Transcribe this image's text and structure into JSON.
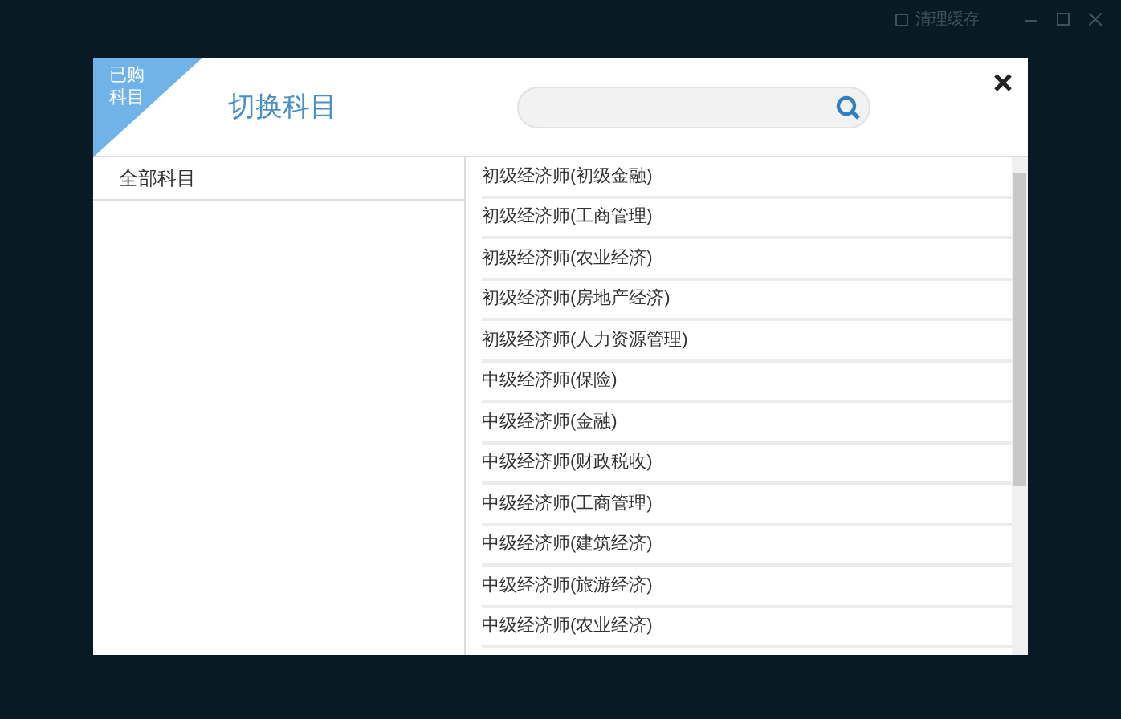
{
  "app_bar": {
    "clear_cache": "清理缓存"
  },
  "dialog": {
    "badge": "已购科目",
    "title": "切换科目",
    "categories": [
      {
        "label": "全部科目",
        "selected": true
      }
    ],
    "subjects": [
      {
        "label": "初级经济师(初级金融)"
      },
      {
        "label": "初级经济师(工商管理)"
      },
      {
        "label": "初级经济师(农业经济)"
      },
      {
        "label": "初级经济师(房地产经济)"
      },
      {
        "label": "初级经济师(人力资源管理)"
      },
      {
        "label": "中级经济师(保险)"
      },
      {
        "label": "中级经济师(金融)"
      },
      {
        "label": "中级经济师(财政税收)"
      },
      {
        "label": "中级经济师(工商管理)"
      },
      {
        "label": "中级经济师(建筑经济)"
      },
      {
        "label": "中级经济师(旅游经济)"
      },
      {
        "label": "中级经济师(农业经济)"
      }
    ]
  }
}
